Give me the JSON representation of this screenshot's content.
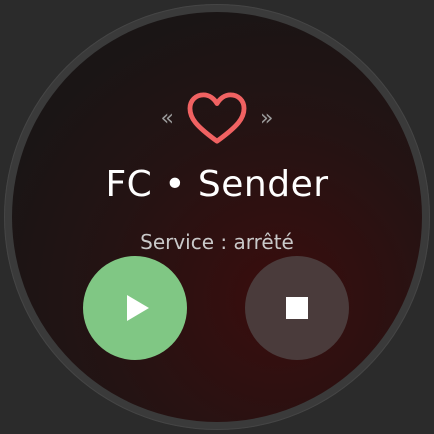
{
  "app": {
    "title": "FC • Sender",
    "status": "Service : arrêté"
  },
  "navigation": {
    "prev_glyph": "«",
    "next_glyph": "»"
  },
  "icons": {
    "center": "heart-icon",
    "start": "play-icon",
    "stop": "stop-icon"
  },
  "colors": {
    "heart_outline": "#f06262",
    "start_button": "#80c784",
    "stop_button": "#4a3b3b",
    "text_primary": "#ffffff",
    "text_secondary": "#c9c9c9"
  }
}
